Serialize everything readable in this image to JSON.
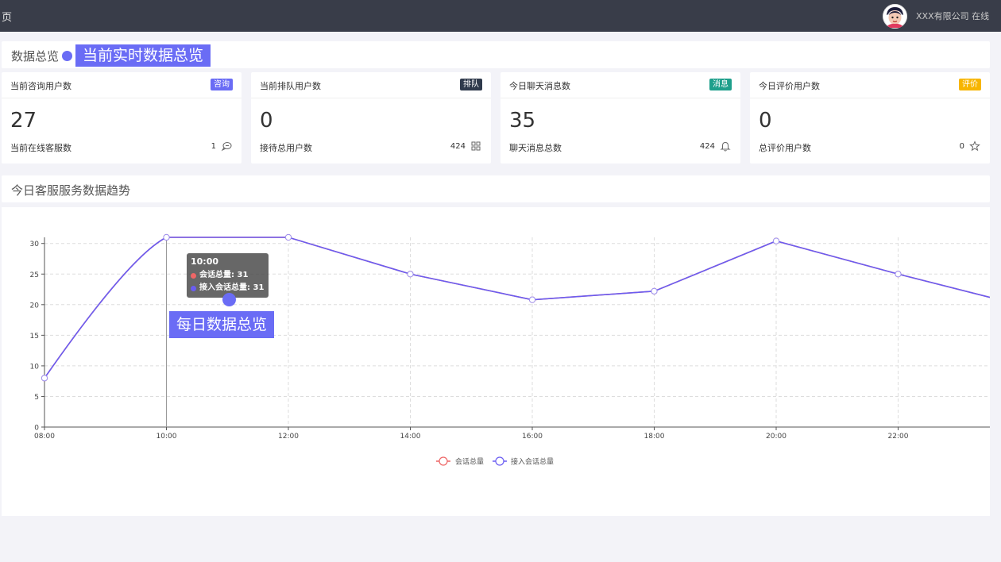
{
  "topbar": {
    "crumb": "页",
    "company": "XXX有限公司 在线"
  },
  "overview": {
    "title": "数据总览",
    "annotation": "当前实时数据总览"
  },
  "cards": [
    {
      "title": "当前咨询用户数",
      "badge": "咨询",
      "badge_color": "#6a6cf5",
      "value": "27",
      "foot_label": "当前在线客服数",
      "foot_value": "1",
      "icon": "chat-icon"
    },
    {
      "title": "当前排队用户数",
      "badge": "排队",
      "badge_color": "#2f3a4c",
      "value": "0",
      "foot_label": "接待总用户数",
      "foot_value": "424",
      "icon": "grid-icon"
    },
    {
      "title": "今日聊天消息数",
      "badge": "消息",
      "badge_color": "#1e9f8b",
      "value": "35",
      "foot_label": "聊天消息总数",
      "foot_value": "424",
      "icon": "bell-icon"
    },
    {
      "title": "今日评价用户数",
      "badge": "评价",
      "badge_color": "#f7b500",
      "value": "0",
      "foot_label": "总评价用户数",
      "foot_value": "0",
      "icon": "star-icon"
    }
  ],
  "trend": {
    "title": "今日客服服务数据趋势",
    "annotation": "每日数据总览"
  },
  "tooltip": {
    "time": "10:00",
    "row1": "会话总量: 31",
    "row2": "接入会话总量: 31"
  },
  "chart_data": {
    "type": "line",
    "x": [
      "08:00",
      "10:00",
      "12:00",
      "14:00",
      "16:00",
      "18:00",
      "20:00",
      "22:00"
    ],
    "series": [
      {
        "name": "会话总量",
        "color": "#ee6666",
        "values": [
          8,
          31,
          31,
          25,
          20.8,
          22.2,
          30.4,
          25
        ]
      },
      {
        "name": "接入会话总量",
        "color": "#6a5df2",
        "values": [
          8,
          31,
          31,
          25,
          20.8,
          22.2,
          30.4,
          25
        ]
      }
    ],
    "ylim": [
      0,
      31
    ],
    "yticks": [
      0,
      5,
      10,
      15,
      20,
      25,
      30
    ],
    "grid": true,
    "legend": "bottom-center"
  },
  "colors": {
    "topbar": "#393d49",
    "accent": "#6a6cf5"
  }
}
